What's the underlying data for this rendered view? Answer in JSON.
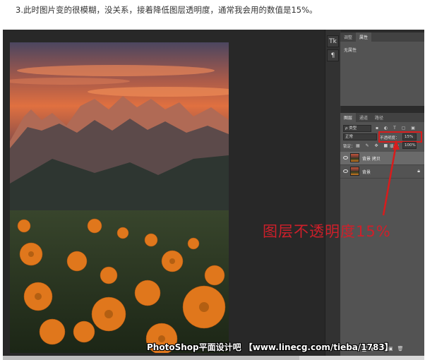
{
  "caption": "3.此时图片变的很模糊，没关系，接着降低图层透明度，通常我会用的数值是15%。",
  "toolbar": {
    "buttons": [
      {
        "label": "Tk",
        "icon": "character-icon"
      },
      {
        "label": "¶",
        "icon": "paragraph-icon"
      }
    ]
  },
  "properties_panel": {
    "tabs": [
      "调整",
      "属性"
    ],
    "active_tab": "属性",
    "empty_text": "无属性"
  },
  "layers_panel": {
    "tabs": [
      "图层",
      "通道",
      "路径"
    ],
    "active_tab": "图层",
    "filter_label": "ρ 类型",
    "blend_mode": "正常",
    "opacity_label": "不透明度：",
    "opacity_value": "15%",
    "lock_label": "锁定：",
    "fill_label": "填充：",
    "fill_value": "100%",
    "layers": [
      {
        "name": "背景 拷贝",
        "selected": true,
        "locked": false
      },
      {
        "name": "背景",
        "selected": false,
        "locked": true
      }
    ],
    "bottom_icons": [
      "link-icon",
      "fx-icon",
      "mask-icon",
      "adjustment-icon",
      "folder-icon",
      "new-layer-icon",
      "trash-icon"
    ]
  },
  "annotation": {
    "text": "图层不透明度15%",
    "color": "#cf1f2a"
  },
  "watermark": "PhotoShop平面设计吧 【www.linecg.com/tieba/1783】"
}
